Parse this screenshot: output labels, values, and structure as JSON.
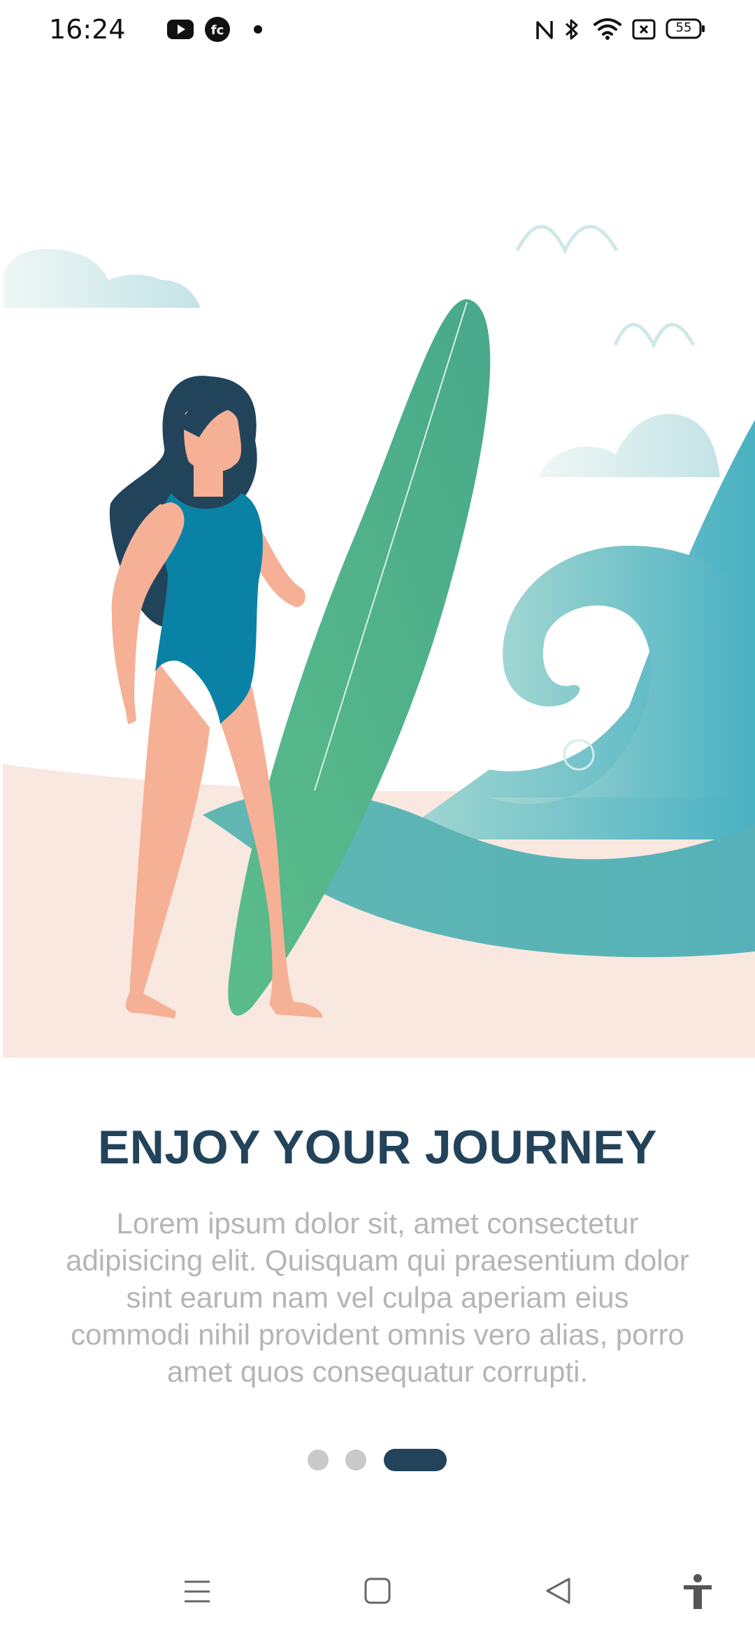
{
  "status_bar": {
    "time": "16:24",
    "battery": "55",
    "notification_icons": [
      "youtube-icon",
      "fc-app-icon",
      "dot-icon"
    ],
    "system_icons": [
      "nfc-icon",
      "bluetooth-icon",
      "wifi-icon",
      "sim-off-icon",
      "battery-icon"
    ]
  },
  "onboarding": {
    "title": "ENJOY YOUR JOURNEY",
    "description": "Lorem ipsum dolor sit, amet consectetur adipisicing elit. Quisquam qui praesentium dolor sint earum nam vel culpa aperiam eius commodi nihil provident omnis vero alias, porro amet quos consequatur corrupti.",
    "pages": 3,
    "active_page": 3
  },
  "navigation_bar": {
    "buttons": [
      "menu-icon",
      "home-icon",
      "back-icon",
      "accessibility-icon"
    ]
  },
  "colors": {
    "title": "#22435a",
    "body_text": "#b5b5b5",
    "dot_inactive": "#c9c9c9",
    "dot_active": "#22435a",
    "surfboard": "#4fae8c",
    "wave": "#5ab9bf",
    "sand": "#f9e8e0",
    "skin": "#f5b096",
    "swimsuit": "#0a82a5",
    "hair": "#22445b"
  }
}
